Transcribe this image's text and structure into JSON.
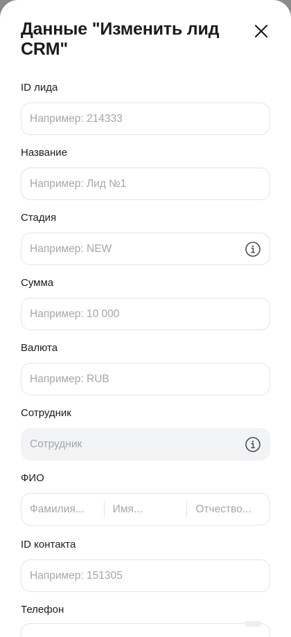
{
  "header": {
    "title": "Данные \"Изменить лид CRM\""
  },
  "fields": [
    {
      "label": "ID лида",
      "placeholder": "Например: 214333"
    },
    {
      "label": "Название",
      "placeholder": "Например: Лид №1"
    },
    {
      "label": "Стадия",
      "placeholder": "Например: NEW"
    },
    {
      "label": "Сумма",
      "placeholder": "Например: 10 000"
    },
    {
      "label": "Валюта",
      "placeholder": "Например: RUB"
    },
    {
      "label": "Сотрудник",
      "placeholder": "Сотрудник"
    },
    {
      "label": "ФИО",
      "placeholders": [
        "Фамилия...",
        "Имя...",
        "Отчество..."
      ]
    },
    {
      "label": "ID контакта",
      "placeholder": "Например: 151305"
    },
    {
      "label": "Телефон"
    }
  ],
  "icons": {
    "close": "close-icon",
    "info": "info-icon"
  },
  "colors": {
    "background": "#ffffff",
    "border": "#e2e3e8",
    "placeholder": "#a4a6ad",
    "disabled_fill": "#f2f3f5",
    "text": "#1b1b1f"
  }
}
